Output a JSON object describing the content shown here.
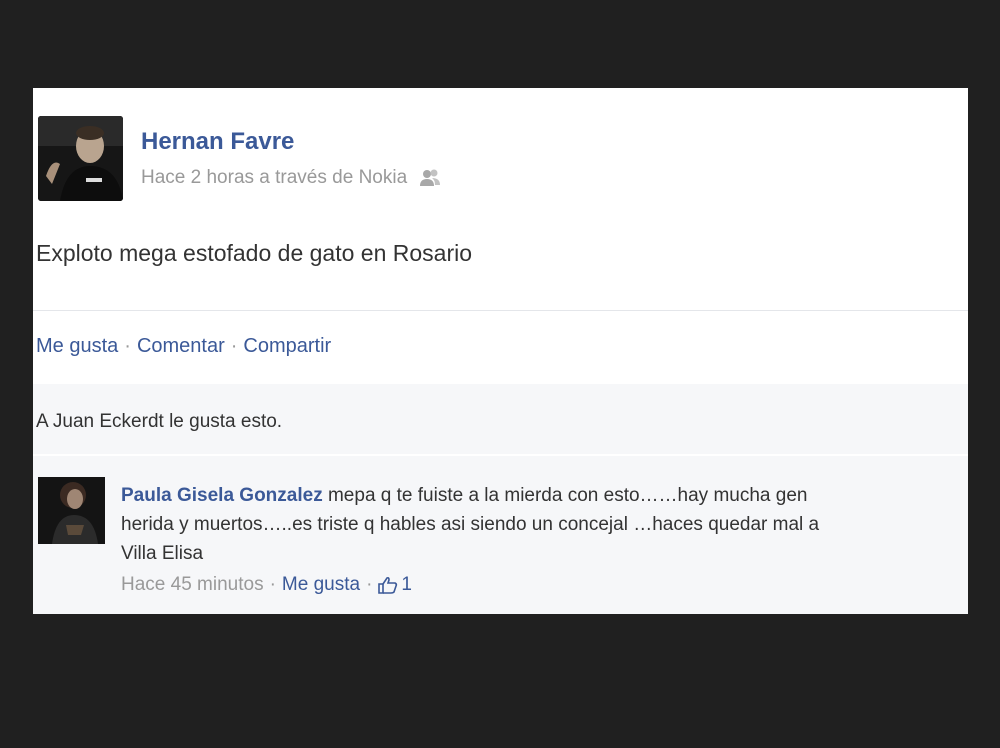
{
  "post": {
    "author": "Hernan Favre",
    "meta": "Hace 2 horas a través de Nokia",
    "audience_icon": "friends-icon",
    "text": "Exploto mega estofado de gato en Rosario",
    "actions": {
      "like": "Me gusta",
      "comment": "Comentar",
      "share": "Compartir",
      "separator": "·"
    },
    "likes_text": "A Juan Eckerdt le gusta esto."
  },
  "comment": {
    "author": "Paula Gisela Gonzalez",
    "line1": "mepa q te fuiste a la mierda con esto……hay mucha gen",
    "line2": "herida y muertos…..es triste q hables asi siendo un concejal …haces quedar mal a",
    "line3": "Villa Elisa",
    "time": "Hace 45 minutos",
    "like": "Me gusta",
    "like_count": "1",
    "separator": "·"
  },
  "colors": {
    "link": "#3b5998",
    "muted": "#999999",
    "background": "#202020"
  }
}
